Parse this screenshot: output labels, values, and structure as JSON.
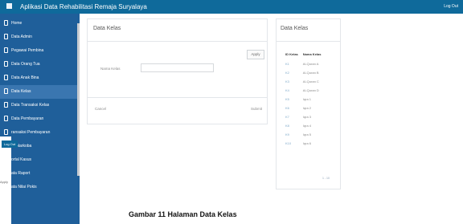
{
  "header": {
    "title": "Aplikasi Data Rehabilitasi Remaja Suryalaya",
    "logout": "Log Out",
    "menu_icon": "hamburger-icon"
  },
  "sidebar": {
    "items": [
      {
        "label": "Home",
        "icon": "document-icon"
      },
      {
        "label": "Data Admin",
        "icon": "document-icon"
      },
      {
        "label": "Pegawai Pembina",
        "icon": "document-icon"
      },
      {
        "label": "Data Orang Tua",
        "icon": "document-icon"
      },
      {
        "label": "Data Anak Bina",
        "icon": "document-icon"
      },
      {
        "label": "Data Kelas",
        "icon": "document-icon",
        "active": true
      },
      {
        "label": "Data Transaksi Kelas",
        "icon": "document-icon"
      },
      {
        "label": "Data Pembayaran",
        "icon": "document-icon"
      },
      {
        "label": "ransaksi Pembayaran",
        "icon": "document-icon"
      },
      {
        "label": "ist Narkoba",
        "icon": "document-icon"
      },
      {
        "label": "ortal Kasus",
        "icon": "document-icon"
      },
      {
        "label": "ata Raport",
        "icon": "document-icon"
      },
      {
        "label": "ata Nilai Pokis",
        "icon": "document-icon"
      }
    ]
  },
  "overlay": {
    "logout": "Log Out",
    "apply": "Apply"
  },
  "form_panel": {
    "title": "Data Kelas",
    "apply": "Apply",
    "field_label": "Nama Kelas",
    "field_value": "",
    "cancel": "Cancel",
    "submit": "Submit"
  },
  "table_panel": {
    "title": "Data Kelas",
    "columns": [
      "ID Kelas",
      "Nama Kelas"
    ],
    "rows": [
      [
        "K1",
        "Al-Quran A"
      ],
      [
        "K2",
        "Al-Quran B"
      ],
      [
        "K3",
        "Al-Quran C"
      ],
      [
        "K4",
        "Al-Quran D"
      ],
      [
        "K5",
        "Iqra 1"
      ],
      [
        "K6",
        "Iqra 2"
      ],
      [
        "K7",
        "Iqra 3"
      ],
      [
        "K8",
        "Iqra 4"
      ],
      [
        "K9",
        "Iqra 5"
      ],
      [
        "K10",
        "Iqra 6"
      ]
    ],
    "pager": "1 - 10"
  },
  "caption": "Gambar 11 Halaman Data Kelas"
}
